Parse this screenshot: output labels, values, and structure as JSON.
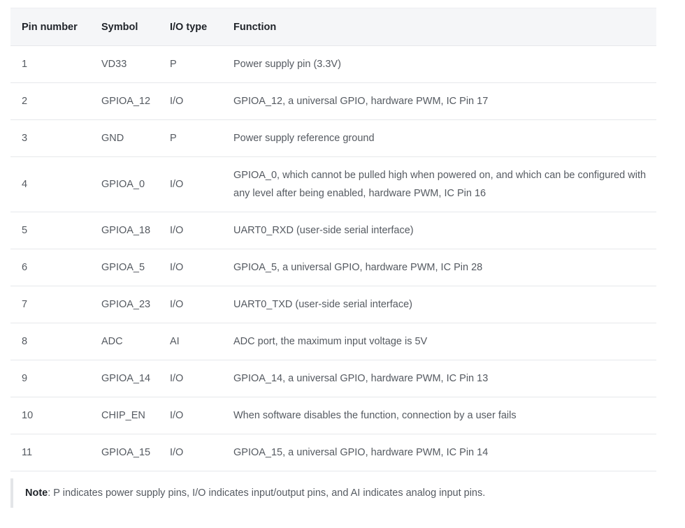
{
  "table": {
    "headers": [
      "Pin number",
      "Symbol",
      "I/O type",
      "Function"
    ],
    "rows": [
      {
        "pin": "1",
        "symbol": "VD33",
        "io": "P",
        "function": "Power supply pin (3.3V)"
      },
      {
        "pin": "2",
        "symbol": "GPIOA_12",
        "io": "I/O",
        "function": "GPIOA_12, a universal GPIO, hardware PWM, IC Pin 17"
      },
      {
        "pin": "3",
        "symbol": "GND",
        "io": "P",
        "function": "Power supply reference ground"
      },
      {
        "pin": "4",
        "symbol": "GPIOA_0",
        "io": "I/O",
        "function": "GPIOA_0, which cannot be pulled high when powered on, and which can be configured with any level after being enabled, hardware PWM, IC Pin 16"
      },
      {
        "pin": "5",
        "symbol": "GPIOA_18",
        "io": "I/O",
        "function": "UART0_RXD (user-side serial interface)"
      },
      {
        "pin": "6",
        "symbol": "GPIOA_5",
        "io": "I/O",
        "function": "GPIOA_5, a universal GPIO, hardware PWM, IC Pin 28"
      },
      {
        "pin": "7",
        "symbol": "GPIOA_23",
        "io": "I/O",
        "function": "UART0_TXD (user-side serial interface)"
      },
      {
        "pin": "8",
        "symbol": "ADC",
        "io": "AI",
        "function": "ADC port, the maximum input voltage is 5V"
      },
      {
        "pin": "9",
        "symbol": "GPIOA_14",
        "io": "I/O",
        "function": "GPIOA_14, a universal GPIO, hardware PWM, IC Pin 13"
      },
      {
        "pin": "10",
        "symbol": "CHIP_EN",
        "io": "I/O",
        "function": "When software disables the function, connection by a user fails"
      },
      {
        "pin": "11",
        "symbol": "GPIOA_15",
        "io": "I/O",
        "function": "GPIOA_15, a universal GPIO, hardware PWM, IC Pin 14"
      }
    ]
  },
  "note": {
    "label": "Note",
    "text": ": P indicates power supply pins, I/O indicates input/output pins, and AI indicates analog input pins."
  }
}
